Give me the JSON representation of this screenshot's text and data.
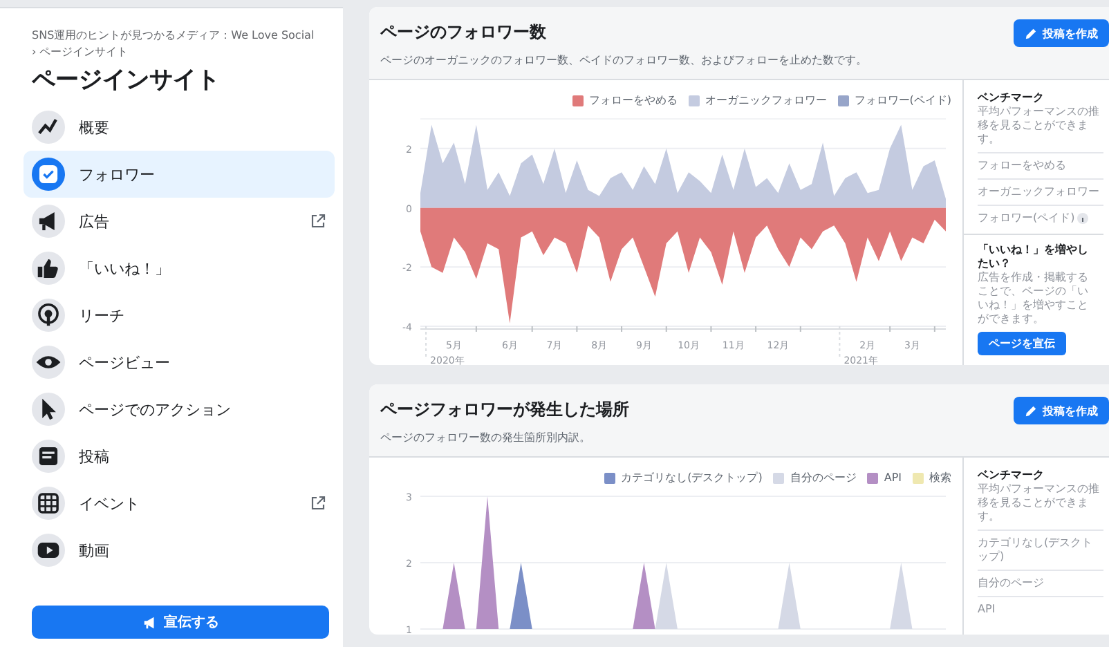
{
  "sidebar": {
    "page_name": "SNS運用のヒントが見つかるメディア：We Love Social",
    "breadcrumb_current": "› ページインサイト",
    "title": "ページインサイト",
    "items": [
      {
        "label": "概要",
        "kind": "trend",
        "selected": false,
        "external": false
      },
      {
        "label": "フォロワー",
        "kind": "follower",
        "selected": true,
        "external": false
      },
      {
        "label": "広告",
        "kind": "megaphone",
        "selected": false,
        "external": true
      },
      {
        "label": "「いいね！」",
        "kind": "thumb",
        "selected": false,
        "external": false
      },
      {
        "label": "リーチ",
        "kind": "reach",
        "selected": false,
        "external": false
      },
      {
        "label": "ページビュー",
        "kind": "eye",
        "selected": false,
        "external": false
      },
      {
        "label": "ページでのアクション",
        "kind": "cursor",
        "selected": false,
        "external": false
      },
      {
        "label": "投稿",
        "kind": "post",
        "selected": false,
        "external": false
      },
      {
        "label": "イベント",
        "kind": "calendar",
        "selected": false,
        "external": true
      },
      {
        "label": "動画",
        "kind": "video",
        "selected": false,
        "external": false
      }
    ],
    "promote_button": "宣伝する"
  },
  "cards": [
    {
      "title": "ページのフォロワー数",
      "description": "ページのオーガニックのフォロワー数、ペイドのフォロワー数、およびフォローを止めた数です。",
      "create_post_button": "投稿を作成",
      "year_labels": [
        "2020年",
        "2021年"
      ],
      "chart_data": {
        "type": "area",
        "categories": [
          null,
          null,
          null,
          "5月",
          null,
          null,
          null,
          null,
          "6月",
          null,
          null,
          null,
          "7月",
          null,
          null,
          null,
          "8月",
          null,
          null,
          null,
          "9月",
          null,
          null,
          null,
          "10月",
          null,
          null,
          null,
          "11月",
          null,
          null,
          null,
          "12月",
          null,
          null,
          null,
          null,
          null,
          null,
          null,
          "2月",
          null,
          null,
          null,
          "3月",
          null,
          null,
          null
        ],
        "ylim": [
          -4,
          3
        ],
        "yticks": [
          -4,
          -2,
          0,
          2
        ],
        "series": [
          {
            "name": "フォローをやめる",
            "color": "#e07a7a",
            "values": [
              -0.8,
              -2.0,
              -2.2,
              -1.0,
              -1.5,
              -2.4,
              -1.2,
              -1.4,
              -3.9,
              -1.0,
              -0.8,
              -1.6,
              -1.0,
              -1.2,
              -2.2,
              -0.6,
              -1.0,
              -2.5,
              -1.4,
              -1.0,
              -2.0,
              -3.0,
              -1.2,
              -0.8,
              -2.2,
              -1.0,
              -1.5,
              -2.6,
              -0.8,
              -2.2,
              -1.0,
              -0.6,
              -1.4,
              -2.0,
              -1.0,
              -1.4,
              -0.8,
              -0.6,
              -1.2,
              -2.5,
              -1.0,
              -1.8,
              -0.8,
              -1.8,
              -1.0,
              -1.2,
              -0.4,
              -0.8
            ]
          },
          {
            "name": "オーガニックフォロワー",
            "color": "#c4cbe0",
            "values": [
              0.5,
              2.8,
              1.5,
              2.2,
              0.8,
              2.8,
              0.6,
              1.2,
              0.4,
              1.5,
              1.8,
              0.8,
              2.0,
              0.5,
              1.6,
              0.6,
              0.4,
              1.0,
              1.2,
              0.6,
              1.4,
              0.8,
              2.0,
              0.5,
              1.2,
              0.9,
              0.5,
              1.8,
              0.6,
              2.0,
              0.7,
              1.0,
              0.5,
              1.5,
              0.6,
              0.8,
              2.2,
              0.4,
              1.0,
              1.2,
              0.5,
              0.6,
              2.0,
              2.8,
              0.6,
              1.4,
              1.6,
              0.3
            ]
          },
          {
            "name": "フォロワー(ペイド)",
            "color": "#97a5c9",
            "values": [
              null,
              null,
              null,
              null,
              null,
              null,
              null,
              null,
              null,
              null,
              null,
              null,
              null,
              null,
              null,
              null,
              null,
              null,
              null,
              null,
              null,
              null,
              null,
              null,
              null,
              null,
              null,
              null,
              null,
              null,
              null,
              null,
              null,
              null,
              null,
              null,
              null,
              null,
              null,
              null,
              null,
              null,
              null,
              null,
              null,
              null,
              null,
              null
            ]
          }
        ]
      },
      "benchmark": {
        "title": "ベンチマーク",
        "description": "平均パフォーマンスの推移を見ることができます。",
        "metrics": [
          {
            "label": "フォローをやめる",
            "info": false
          },
          {
            "label": "オーガニックフォロワー",
            "info": false
          },
          {
            "label": "フォロワー(ペイド)",
            "info": true
          }
        ]
      },
      "promo": {
        "title": "「いいね！」を増やしたい？",
        "description": "広告を作成・掲載することで、ページの「いいね！」を増やすことができます。",
        "button": "ページを宣伝"
      }
    },
    {
      "title": "ページフォロワーが発生した場所",
      "description": "ページのフォロワー数の発生箇所別内訳。",
      "create_post_button": "投稿を作成",
      "chart_data": {
        "type": "area",
        "ylim": [
          1,
          3
        ],
        "yticks": [
          1,
          2,
          3
        ],
        "series": [
          {
            "name": "カテゴリなし(デスクトップ)",
            "color": "#7b8fc7",
            "values": [
              null,
              null,
              null,
              null,
              null,
              null,
              null,
              null,
              1,
              2,
              1,
              null,
              null,
              null,
              null,
              null,
              null,
              null,
              null,
              null,
              null,
              null,
              null,
              null,
              null,
              null,
              null,
              null,
              null,
              null,
              null,
              null,
              null,
              null,
              null,
              null,
              null,
              null,
              null,
              null,
              null,
              null,
              null,
              null,
              null,
              null,
              null,
              null
            ]
          },
          {
            "name": "自分のページ",
            "color": "#d5d9e6",
            "values": [
              null,
              null,
              null,
              null,
              null,
              null,
              null,
              null,
              null,
              null,
              null,
              null,
              null,
              null,
              null,
              null,
              null,
              null,
              null,
              null,
              null,
              1,
              2,
              1,
              null,
              null,
              null,
              null,
              null,
              null,
              null,
              null,
              1,
              2,
              1,
              null,
              null,
              null,
              null,
              null,
              null,
              null,
              1,
              2,
              1,
              null,
              null,
              null
            ]
          },
          {
            "name": "API",
            "color": "#b48fc4",
            "values": [
              null,
              null,
              1,
              2,
              1,
              1,
              3,
              1,
              null,
              null,
              null,
              null,
              null,
              null,
              null,
              null,
              null,
              null,
              null,
              1,
              2,
              1,
              null,
              null,
              null,
              null,
              null,
              null,
              null,
              null,
              null,
              null,
              null,
              null,
              null,
              null,
              null,
              null,
              null,
              null,
              null,
              null,
              null,
              null,
              null,
              null,
              null,
              null
            ]
          },
          {
            "name": "検索",
            "color": "#efe8b0",
            "values": [
              null,
              null,
              null,
              null,
              null,
              null,
              null,
              null,
              null,
              null,
              null,
              null,
              null,
              null,
              null,
              null,
              null,
              null,
              null,
              null,
              null,
              null,
              null,
              null,
              null,
              null,
              null,
              null,
              null,
              null,
              null,
              null,
              null,
              null,
              null,
              null,
              null,
              null,
              null,
              null,
              null,
              null,
              null,
              null,
              null,
              null,
              null,
              null
            ]
          }
        ]
      },
      "benchmark": {
        "title": "ベンチマーク",
        "description": "平均パフォーマンスの推移を見ることができます。",
        "metrics": [
          {
            "label": "カテゴリなし(デスクトップ)",
            "info": false
          },
          {
            "label": "自分のページ",
            "info": false
          },
          {
            "label": "API",
            "info": false
          }
        ]
      }
    }
  ]
}
